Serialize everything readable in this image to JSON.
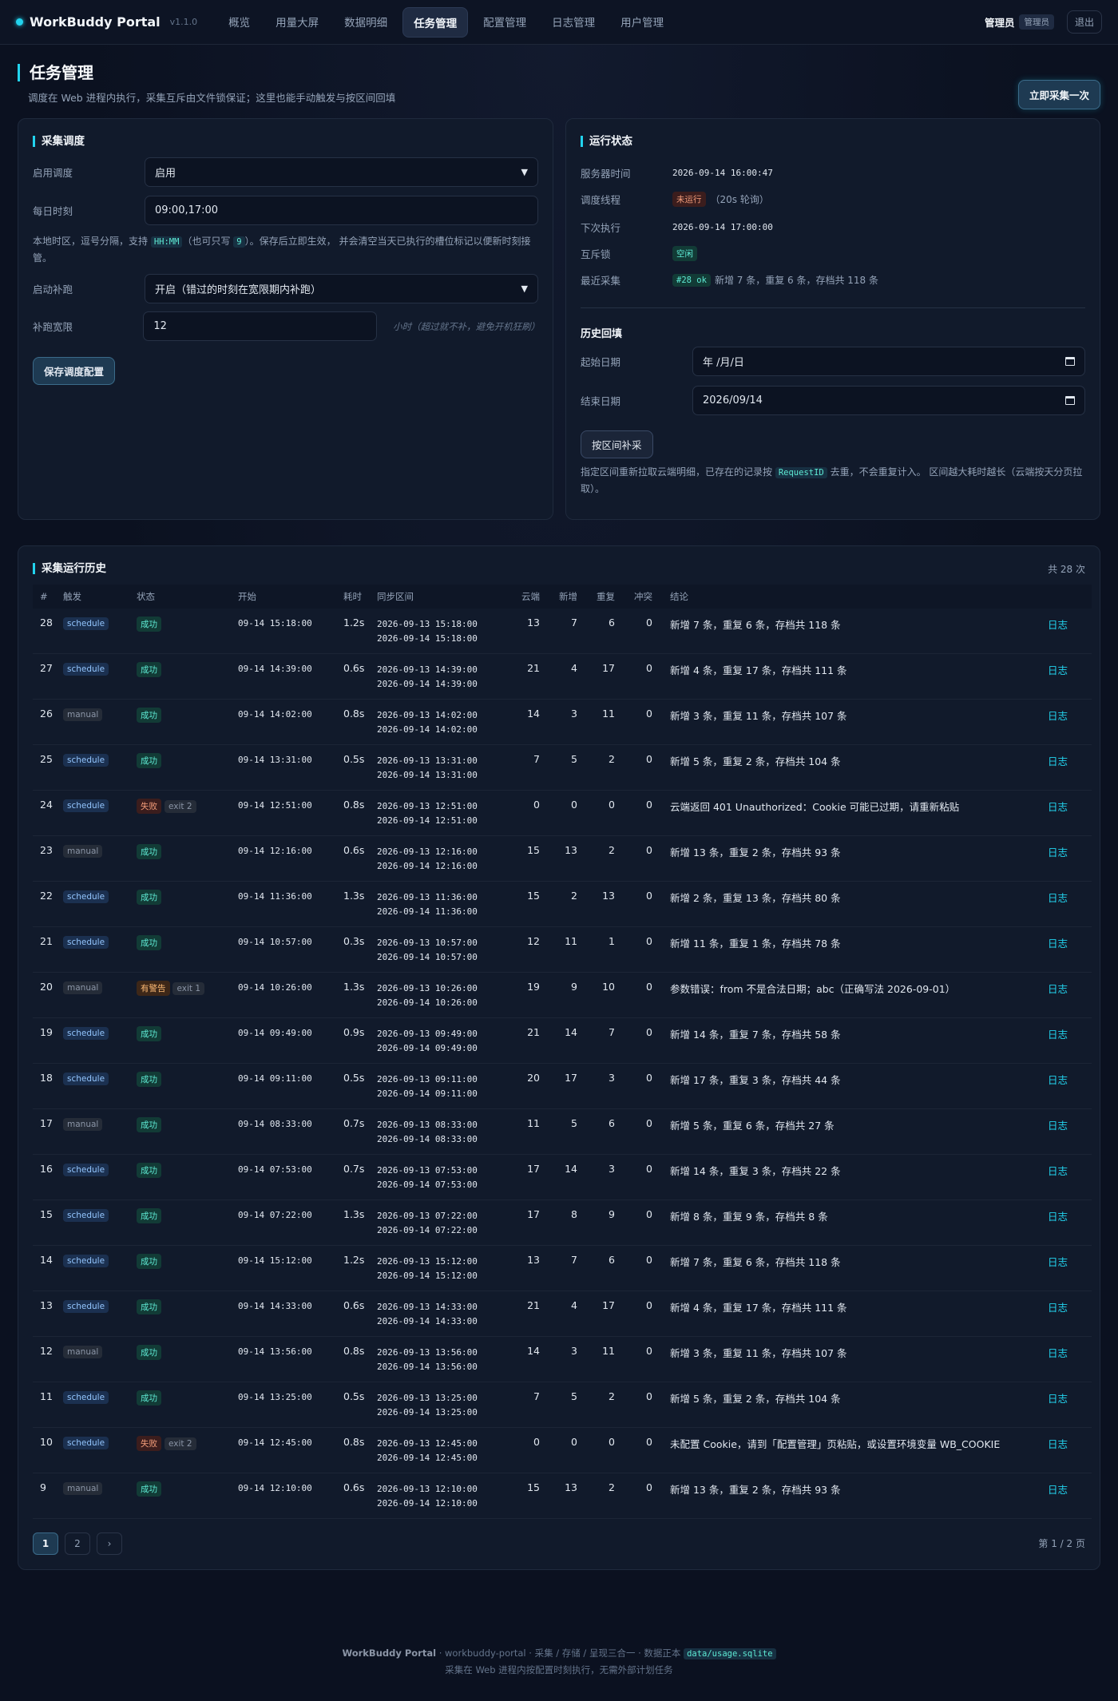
{
  "app": {
    "name": "WorkBuddy Portal",
    "version": "v1.1.0"
  },
  "nav": [
    {
      "label": "概览",
      "active": false
    },
    {
      "label": "用量大屏",
      "active": false
    },
    {
      "label": "数据明细",
      "active": false
    },
    {
      "label": "任务管理",
      "active": true
    },
    {
      "label": "配置管理",
      "active": false
    },
    {
      "label": "日志管理",
      "active": false
    },
    {
      "label": "用户管理",
      "active": false
    }
  ],
  "user": {
    "name": "管理员",
    "role": "管理员",
    "logout": "退出"
  },
  "page": {
    "title": "任务管理",
    "subtitle": "调度在 Web 进程内执行，采集互斥由文件锁保证；这里也能手动触发与按区间回填",
    "collect_now": "立即采集一次"
  },
  "schedule": {
    "title": "采集调度",
    "enable_label": "启用调度",
    "enable_value": "启用",
    "times_label": "每日时刻",
    "times_value": "09:00,17:00",
    "hint_prefix": "本地时区，逗号分隔，支持",
    "hint_code1": "HH:MM",
    "hint_mid": "（也可只写",
    "hint_code2": "9",
    "hint_suffix": "）。保存后立即生效， 并会清空当天已执行的槽位标记以便新时刻接管。",
    "catchup_label": "启动补跑",
    "catchup_value": "开启（错过的时刻在宽限期内补跑）",
    "grace_label": "补跑宽限",
    "grace_value": "12",
    "grace_hint": "小时（超过就不补，避免开机狂刷）",
    "save": "保存调度配置"
  },
  "runtime": {
    "title": "运行状态",
    "server_time_label": "服务器时间",
    "server_time": "2026-09-14 16:00:47",
    "thread_label": "调度线程",
    "thread_status": "未运行",
    "thread_note": "（20s 轮询）",
    "next_label": "下次执行",
    "next_time": "2026-09-14 17:00:00",
    "lock_label": "互斥锁",
    "lock_status": "空闲",
    "last_label": "最近采集",
    "last_tag": "#28 ok",
    "last_text": "新增 7 条，重复 6 条，存档共 118 条"
  },
  "backfill": {
    "title": "历史回填",
    "start_label": "起始日期",
    "start_value": "年 /月/日",
    "end_label": "结束日期",
    "end_value": "2026/09/14",
    "button": "按区间补采",
    "hint_prefix": "指定区间重新拉取云端明细，已存在的记录按",
    "hint_code": "RequestID",
    "hint_suffix": "去重，不会重复计入。 区间越大耗时越长（云端按天分页拉取）。"
  },
  "history": {
    "title": "采集运行历史",
    "total": "共 28 次",
    "columns": [
      "#",
      "触发",
      "状态",
      "开始",
      "耗时",
      "同步区间",
      "云端",
      "新增",
      "重复",
      "冲突",
      "结论"
    ],
    "log_label": "日志",
    "rows": [
      {
        "id": "28",
        "trigger": "schedule",
        "status": "成功",
        "exit": "",
        "start": "09-14 15:18:00",
        "dur": "1.2s",
        "r1": "2026-09-13 15:18:00",
        "r2": "2026-09-14 15:18:00",
        "cloud": "13",
        "new": "7",
        "dup": "6",
        "conf": "0",
        "concl": "新增 7 条，重复 6 条，存档共 118 条"
      },
      {
        "id": "27",
        "trigger": "schedule",
        "status": "成功",
        "exit": "",
        "start": "09-14 14:39:00",
        "dur": "0.6s",
        "r1": "2026-09-13 14:39:00",
        "r2": "2026-09-14 14:39:00",
        "cloud": "21",
        "new": "4",
        "dup": "17",
        "conf": "0",
        "concl": "新增 4 条，重复 17 条，存档共 111 条"
      },
      {
        "id": "26",
        "trigger": "manual",
        "status": "成功",
        "exit": "",
        "start": "09-14 14:02:00",
        "dur": "0.8s",
        "r1": "2026-09-13 14:02:00",
        "r2": "2026-09-14 14:02:00",
        "cloud": "14",
        "new": "3",
        "dup": "11",
        "conf": "0",
        "concl": "新增 3 条，重复 11 条，存档共 107 条"
      },
      {
        "id": "25",
        "trigger": "schedule",
        "status": "成功",
        "exit": "",
        "start": "09-14 13:31:00",
        "dur": "0.5s",
        "r1": "2026-09-13 13:31:00",
        "r2": "2026-09-14 13:31:00",
        "cloud": "7",
        "new": "5",
        "dup": "2",
        "conf": "0",
        "concl": "新增 5 条，重复 2 条，存档共 104 条"
      },
      {
        "id": "24",
        "trigger": "schedule",
        "status": "失败",
        "exit": "exit 2",
        "start": "09-14 12:51:00",
        "dur": "0.8s",
        "r1": "2026-09-13 12:51:00",
        "r2": "2026-09-14 12:51:00",
        "cloud": "0",
        "new": "0",
        "dup": "0",
        "conf": "0",
        "concl": "云端返回 401 Unauthorized：Cookie 可能已过期，请重新粘贴"
      },
      {
        "id": "23",
        "trigger": "manual",
        "status": "成功",
        "exit": "",
        "start": "09-14 12:16:00",
        "dur": "0.6s",
        "r1": "2026-09-13 12:16:00",
        "r2": "2026-09-14 12:16:00",
        "cloud": "15",
        "new": "13",
        "dup": "2",
        "conf": "0",
        "concl": "新增 13 条，重复 2 条，存档共 93 条"
      },
      {
        "id": "22",
        "trigger": "schedule",
        "status": "成功",
        "exit": "",
        "start": "09-14 11:36:00",
        "dur": "1.3s",
        "r1": "2026-09-13 11:36:00",
        "r2": "2026-09-14 11:36:00",
        "cloud": "15",
        "new": "2",
        "dup": "13",
        "conf": "0",
        "concl": "新增 2 条，重复 13 条，存档共 80 条"
      },
      {
        "id": "21",
        "trigger": "schedule",
        "status": "成功",
        "exit": "",
        "start": "09-14 10:57:00",
        "dur": "0.3s",
        "r1": "2026-09-13 10:57:00",
        "r2": "2026-09-14 10:57:00",
        "cloud": "12",
        "new": "11",
        "dup": "1",
        "conf": "0",
        "concl": "新增 11 条，重复 1 条，存档共 78 条"
      },
      {
        "id": "20",
        "trigger": "manual",
        "status": "有警告",
        "exit": "exit 1",
        "start": "09-14 10:26:00",
        "dur": "1.3s",
        "r1": "2026-09-13 10:26:00",
        "r2": "2026-09-14 10:26:00",
        "cloud": "19",
        "new": "9",
        "dup": "10",
        "conf": "0",
        "concl": "参数错误：from 不是合法日期；abc（正确写法 2026-09-01）"
      },
      {
        "id": "19",
        "trigger": "schedule",
        "status": "成功",
        "exit": "",
        "start": "09-14 09:49:00",
        "dur": "0.9s",
        "r1": "2026-09-13 09:49:00",
        "r2": "2026-09-14 09:49:00",
        "cloud": "21",
        "new": "14",
        "dup": "7",
        "conf": "0",
        "concl": "新增 14 条，重复 7 条，存档共 58 条"
      },
      {
        "id": "18",
        "trigger": "schedule",
        "status": "成功",
        "exit": "",
        "start": "09-14 09:11:00",
        "dur": "0.5s",
        "r1": "2026-09-13 09:11:00",
        "r2": "2026-09-14 09:11:00",
        "cloud": "20",
        "new": "17",
        "dup": "3",
        "conf": "0",
        "concl": "新增 17 条，重复 3 条，存档共 44 条"
      },
      {
        "id": "17",
        "trigger": "manual",
        "status": "成功",
        "exit": "",
        "start": "09-14 08:33:00",
        "dur": "0.7s",
        "r1": "2026-09-13 08:33:00",
        "r2": "2026-09-14 08:33:00",
        "cloud": "11",
        "new": "5",
        "dup": "6",
        "conf": "0",
        "concl": "新增 5 条，重复 6 条，存档共 27 条"
      },
      {
        "id": "16",
        "trigger": "schedule",
        "status": "成功",
        "exit": "",
        "start": "09-14 07:53:00",
        "dur": "0.7s",
        "r1": "2026-09-13 07:53:00",
        "r2": "2026-09-14 07:53:00",
        "cloud": "17",
        "new": "14",
        "dup": "3",
        "conf": "0",
        "concl": "新增 14 条，重复 3 条，存档共 22 条"
      },
      {
        "id": "15",
        "trigger": "schedule",
        "status": "成功",
        "exit": "",
        "start": "09-14 07:22:00",
        "dur": "1.3s",
        "r1": "2026-09-13 07:22:00",
        "r2": "2026-09-14 07:22:00",
        "cloud": "17",
        "new": "8",
        "dup": "9",
        "conf": "0",
        "concl": "新增 8 条，重复 9 条，存档共 8 条"
      },
      {
        "id": "14",
        "trigger": "schedule",
        "status": "成功",
        "exit": "",
        "start": "09-14 15:12:00",
        "dur": "1.2s",
        "r1": "2026-09-13 15:12:00",
        "r2": "2026-09-14 15:12:00",
        "cloud": "13",
        "new": "7",
        "dup": "6",
        "conf": "0",
        "concl": "新增 7 条，重复 6 条，存档共 118 条"
      },
      {
        "id": "13",
        "trigger": "schedule",
        "status": "成功",
        "exit": "",
        "start": "09-14 14:33:00",
        "dur": "0.6s",
        "r1": "2026-09-13 14:33:00",
        "r2": "2026-09-14 14:33:00",
        "cloud": "21",
        "new": "4",
        "dup": "17",
        "conf": "0",
        "concl": "新增 4 条，重复 17 条，存档共 111 条"
      },
      {
        "id": "12",
        "trigger": "manual",
        "status": "成功",
        "exit": "",
        "start": "09-14 13:56:00",
        "dur": "0.8s",
        "r1": "2026-09-13 13:56:00",
        "r2": "2026-09-14 13:56:00",
        "cloud": "14",
        "new": "3",
        "dup": "11",
        "conf": "0",
        "concl": "新增 3 条，重复 11 条，存档共 107 条"
      },
      {
        "id": "11",
        "trigger": "schedule",
        "status": "成功",
        "exit": "",
        "start": "09-14 13:25:00",
        "dur": "0.5s",
        "r1": "2026-09-13 13:25:00",
        "r2": "2026-09-14 13:25:00",
        "cloud": "7",
        "new": "5",
        "dup": "2",
        "conf": "0",
        "concl": "新增 5 条，重复 2 条，存档共 104 条"
      },
      {
        "id": "10",
        "trigger": "schedule",
        "status": "失败",
        "exit": "exit 2",
        "start": "09-14 12:45:00",
        "dur": "0.8s",
        "r1": "2026-09-13 12:45:00",
        "r2": "2026-09-14 12:45:00",
        "cloud": "0",
        "new": "0",
        "dup": "0",
        "conf": "0",
        "concl": "未配置 Cookie，请到「配置管理」页粘贴，或设置环境变量 WB_COOKIE"
      },
      {
        "id": "9",
        "trigger": "manual",
        "status": "成功",
        "exit": "",
        "start": "09-14 12:10:00",
        "dur": "0.6s",
        "r1": "2026-09-13 12:10:00",
        "r2": "2026-09-14 12:10:00",
        "cloud": "15",
        "new": "13",
        "dup": "2",
        "conf": "0",
        "concl": "新增 13 条，重复 2 条，存档共 93 条"
      }
    ],
    "pages": [
      "1",
      "2",
      "›"
    ],
    "page_info": "第 1 / 2 页"
  },
  "footer": {
    "brand": "WorkBuddy Portal",
    "line1": "· workbuddy-portal · 采集 / 存储 / 呈现三合一 · 数据正本",
    "code": "data/usage.sqlite",
    "line2": "采集在 Web 进程内按配置时刻执行，无需外部计划任务"
  }
}
